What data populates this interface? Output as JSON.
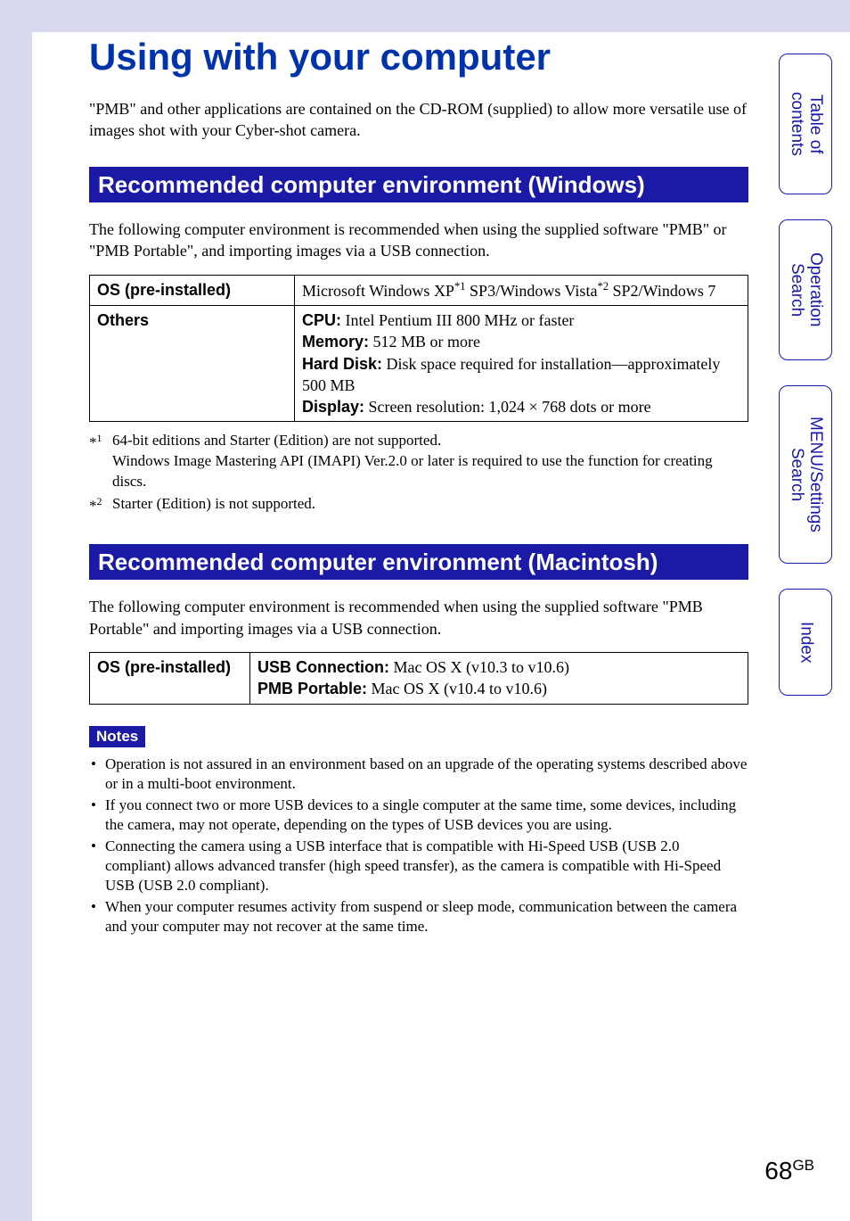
{
  "page": {
    "title": "Using with your computer",
    "intro": "\"PMB\" and other applications are contained on the CD-ROM (supplied) to allow more versatile use of images shot with your Cyber-shot camera.",
    "number": "68",
    "number_suffix": "GB"
  },
  "side_tabs": [
    {
      "label": "Table of\ncontents"
    },
    {
      "label": "Operation\nSearch"
    },
    {
      "label": "MENU/Settings\nSearch"
    },
    {
      "label": "Index"
    }
  ],
  "windows_section": {
    "header": "Recommended computer environment (Windows)",
    "intro": "The following computer environment is recommended when using the supplied software \"PMB\" or \"PMB Portable\", and importing images via a USB connection.",
    "table": {
      "os_label": "OS (pre-installed)",
      "os_value_prefix": "Microsoft Windows XP",
      "os_value_sup1": "*1",
      "os_value_mid": " SP3/Windows Vista",
      "os_value_sup2": "*2",
      "os_value_suffix": " SP2/Windows 7",
      "others_label": "Others",
      "cpu_label": "CPU:",
      "cpu_value": " Intel Pentium III 800 MHz or faster",
      "memory_label": "Memory:",
      "memory_value": " 512 MB or more",
      "hdd_label": "Hard Disk:",
      "hdd_value": " Disk space required for installation—approximately 500 MB",
      "display_label": "Display:",
      "display_value": " Screen resolution: 1,024 × 768 dots or more"
    },
    "footnotes": [
      {
        "marker": "*1",
        "text": "64-bit editions and Starter (Edition) are not supported.\nWindows Image Mastering API (IMAPI) Ver.2.0 or later is required to use the function for creating discs."
      },
      {
        "marker": "*2",
        "text": "Starter (Edition) is not supported."
      }
    ]
  },
  "mac_section": {
    "header": "Recommended computer environment (Macintosh)",
    "intro": "The following computer environment is recommended when using the supplied software \"PMB Portable\" and importing images via a USB connection.",
    "table": {
      "os_label": "OS (pre-installed)",
      "usb_label": "USB Connection:",
      "usb_value": " Mac OS X (v10.3 to v10.6)",
      "pmb_label": "PMB Portable:",
      "pmb_value": " Mac OS X (v10.4 to v10.6)"
    }
  },
  "notes_section": {
    "label": "Notes",
    "items": [
      "Operation is not assured in an environment based on an upgrade of the operating systems described above or in a multi-boot environment.",
      "If you connect two or more USB devices to a single computer at the same time, some devices, including the camera, may not operate, depending on the types of USB devices you are using.",
      "Connecting the camera using a USB interface that is compatible with Hi-Speed USB (USB 2.0 compliant) allows advanced transfer (high speed transfer), as the camera is compatible with Hi-Speed USB (USB 2.0 compliant).",
      "When your computer resumes activity from suspend or sleep mode, communication between the camera and your computer may not recover at the same time."
    ]
  }
}
